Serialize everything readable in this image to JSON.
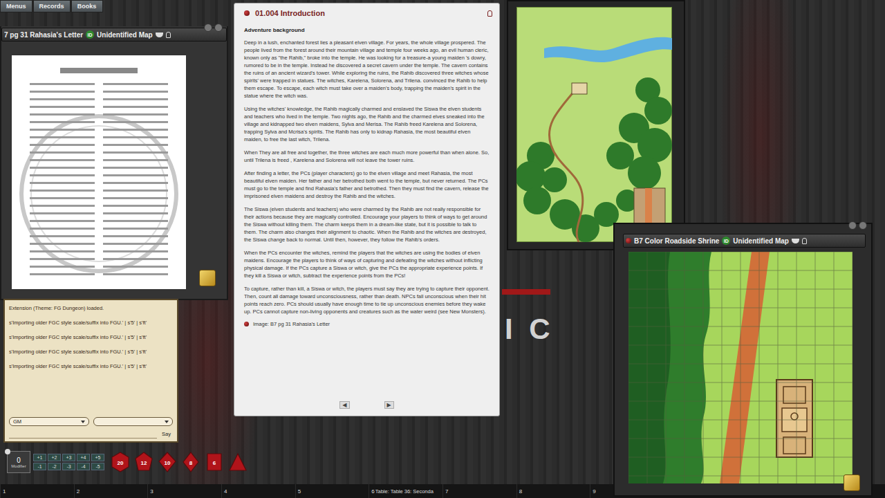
{
  "menu_buttons": [
    "Menus",
    "Records",
    "Books"
  ],
  "backdrop_text": "I C",
  "letter_window": {
    "title": "7 pg 31 Rahasia's Letter",
    "id_badge": "ID",
    "id_label": "Unidentified Map"
  },
  "shrine_window": {
    "title": "B7 Color Roadside Shrine",
    "id_badge": "ID",
    "id_label": "Unidentified Map"
  },
  "story": {
    "title": "01.004 Introduction",
    "heading": "Adventure background",
    "paragraphs": [
      "Deep in a lush, enchanted forest lies a pleasant elven village. For years, the whole village prospered. The people lived from the forest around their mountain village and temple four weeks ago, an evil human cleric, known only as \"the Rahib,\" broke into the temple. He was looking for a treasure-a young maiden 's dowry, rumored to be in the temple. Instead he discovered a secret cavern under the temple. The cavern contains the ruins of an ancient wizard's tower. While exploring the ruins, the Rahib discovered three witches whose spirits' were trapped in statues. The witches, Karelena, Solorena, and Trilena. convinced the Rahib to help them escape. To escape, each witch must take over a maiden's body, trapping the maiden's spirit in the statue where the witch was.",
      "Using the witches' knowledge, the Rahib magically charmed and enslaved the Siswa the elven students and teachers who lived in the temple. Two nights ago, the Rahib and the charmed elves sneaked into the village and kidnapped two elven maidens, Sylva and Merisa. The Rahib freed Karelena and Solorena, trapping Sylva and Mcrisa's spirits. The Rahib has only to kidnap Rahasia, the most beautiful elven maiden, to free the last witch, Trilena.",
      "When They are all free and together, the three witches are each much more powerful than when alone. So, until Trilena is freed , Karelena and Solorena will not leave the tower ruins.",
      "After finding a letter, the PCs (player characters) go to the elven village and meet Rahasia, the most beautiful elven maiden. Her father and her betrothed both went to the temple, but never returned. The PCs must go to the temple and find Rahasia's father and betrothed. Then they must find the cavern, release the imprisoned elven maidens and destroy the Rahib and the witches.",
      "The Siswa (elven students and teachers) who were charmed by the Rahib are not really responsible for their actions because they are magically controlled. Encourage your players to think of ways to get around the Siswa without killing them. The charm keeps them in a dream-like state, but it is possible to talk to them. The charm also changes their alignment to chaotic. When the Rahib and the witches are destroyed, the Siswa change back to normal. Until then, however, they follow the Rahib's orders.",
      "When the PCs encounter the witches, remind the players that the witches are using the bodies of elven maidens. Encourage the players to think of ways of capturing and defeating the witches without inflicting physical damage. If the PCs capture a Siswa or witch, give the PCs the appropriate experience points. If they kill a Siswa or witch, subtract the experience points from the PCs!",
      "To capture, rather than kill, a Siswa or witch, the players must say they are trying to capture their opponent. Then, count all damage toward unconsciousness, rather than death. NPCs fall unconscious when their hit points reach zero. PCs should usually have enough time to tie up unconscious enemies before they wake up. PCs cannot capture non-living opponents and creatures such as the water weird (see New Monsters)."
    ],
    "link": "Image: B7 pg 31 Rahasia's Letter",
    "nav": [
      "◀",
      "▶"
    ]
  },
  "chat": {
    "messages": [
      "Extension (Theme: FG Dungeon) loaded.",
      "s'Importing older FGC style scale/suffix into FGU.' | s'5' | s'ft'",
      "s'Importing older FGC style scale/suffix into FGU.' | s'5' | s'ft'",
      "s'Importing older FGC style scale/suffix into FGU.' | s'5' | s'ft'",
      "s'Importing older FGC style scale/suffix into FGU.' | s'5' | s'ft'"
    ],
    "identity": "GM",
    "mode": "",
    "say_button": "Say"
  },
  "dice_tray": {
    "modifier": {
      "value": "0",
      "label": "Modifier"
    },
    "plus": [
      "+1",
      "+2",
      "+3",
      "+4",
      "+5"
    ],
    "minus": [
      "-1",
      "-2",
      "-3",
      "-4",
      "-5"
    ],
    "dice": [
      {
        "kind": "d20",
        "label": "20"
      },
      {
        "kind": "d12",
        "label": "12"
      },
      {
        "kind": "d10",
        "label": "10"
      },
      {
        "kind": "d8",
        "label": "8"
      },
      {
        "kind": "d6",
        "label": "6"
      },
      {
        "kind": "d4"
      }
    ]
  },
  "hotkeys": [
    "1",
    "2",
    "3",
    "4",
    "5",
    "6",
    "7",
    "8",
    "9"
  ],
  "table_label": "Table: Table 36: Seconda"
}
